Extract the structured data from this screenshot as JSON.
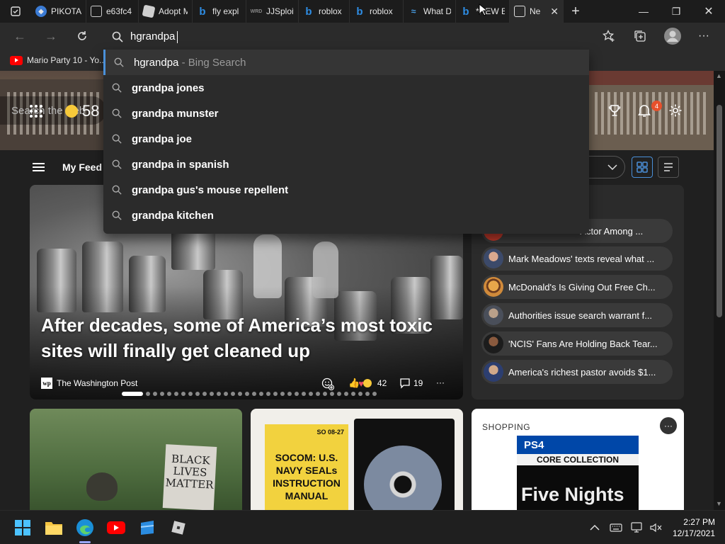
{
  "tabs": [
    {
      "label": "PIKOTA",
      "favicon": "edge-shield-icon"
    },
    {
      "label": "e63fc4",
      "favicon": "page-icon"
    },
    {
      "label": "Adopt M",
      "favicon": "roblox-icon"
    },
    {
      "label": "fly expl",
      "favicon": "bing-icon"
    },
    {
      "label": "JJSploit",
      "favicon": "wrd-icon"
    },
    {
      "label": "roblox",
      "favicon": "bing-icon"
    },
    {
      "label": "roblox",
      "favicon": "bing-icon"
    },
    {
      "label": "What D",
      "favicon": "wave-icon"
    },
    {
      "label": "*NEW E",
      "favicon": "bing-icon"
    },
    {
      "label": "Ne",
      "favicon": "newtab-icon",
      "active": true
    }
  ],
  "address_bar": {
    "text": "hgrandpa"
  },
  "bookmarks": [
    {
      "label": "Mario Party 10 - Yo..."
    }
  ],
  "suggestions": [
    {
      "query": "hgrandpa",
      "suffix": " - Bing Search"
    },
    {
      "query": "grandpa jones"
    },
    {
      "query": "grandpa munster"
    },
    {
      "query": "grandpa joe"
    },
    {
      "query": "grandpa in spanish"
    },
    {
      "query": "grandpa gus's mouse repellent"
    },
    {
      "query": "grandpa kitchen"
    }
  ],
  "page": {
    "search_placeholder": "Search the web",
    "weather_temp": "58",
    "notification_count": "4",
    "feed_label": "My Feed"
  },
  "hero": {
    "title": "After decades, some of America’s most toxic sites will finally get cleaned up",
    "source": "The Washington Post",
    "source_logo": "wp",
    "reactions": "42",
    "comments": "19"
  },
  "trending": [
    {
      "title": "' Actor Among ..."
    },
    {
      "title": "Mark Meadows' texts reveal what ..."
    },
    {
      "title": "McDonald's Is Giving Out Free Ch..."
    },
    {
      "title": "Authorities issue search warrant f..."
    },
    {
      "title": "'NCIS' Fans Are Holding Back Tear..."
    },
    {
      "title": "America's richest pastor avoids $1..."
    }
  ],
  "cards": {
    "sign_text": "BLACK LIVES MATTER",
    "manual_code": "SO 08-27",
    "manual_title": "SOCOM: U.S. NAVY SEALs INSTRUCTION MANUAL",
    "shopping_label": "SHOPPING",
    "ps4_brand": "PS4",
    "ps4_collection": "CORE COLLECTION",
    "ps4_game": "Five Nights"
  },
  "taskbar": {
    "time": "2:27 PM",
    "date": "12/17/2021"
  },
  "colors": {
    "accent": "#4a90d9",
    "badge": "#e8502b"
  }
}
